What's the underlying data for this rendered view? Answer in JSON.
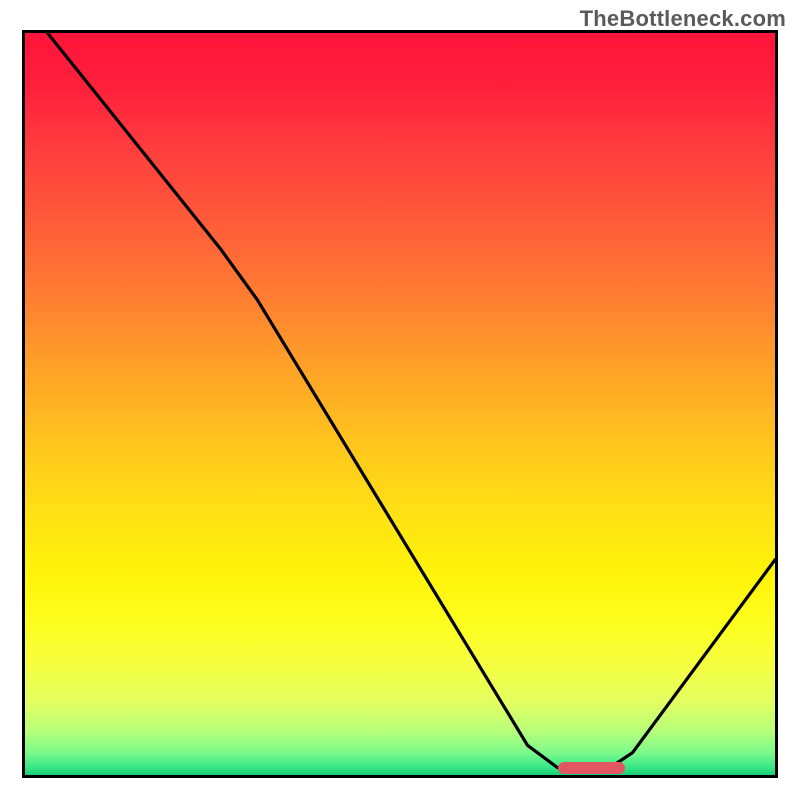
{
  "watermark_text": "TheBottleneck.com",
  "chart_data": {
    "type": "line",
    "title": "",
    "xlabel": "",
    "ylabel": "",
    "xlim": [
      0,
      100
    ],
    "ylim": [
      0,
      100
    ],
    "grid": false,
    "legend": false,
    "curve_points": [
      {
        "x": 3,
        "y": 100
      },
      {
        "x": 26,
        "y": 71
      },
      {
        "x": 31,
        "y": 64
      },
      {
        "x": 67,
        "y": 4
      },
      {
        "x": 71,
        "y": 1
      },
      {
        "x": 78,
        "y": 1
      },
      {
        "x": 81,
        "y": 3
      },
      {
        "x": 100,
        "y": 29
      }
    ],
    "optimal_marker": {
      "x_start": 71,
      "x_end": 80,
      "y": 1
    },
    "background_gradient_colors": {
      "top": "#ff143a",
      "middle": "#fff40a",
      "bottom": "#17cf72"
    },
    "curve_color": "#000000",
    "marker_color": "#e25663"
  }
}
